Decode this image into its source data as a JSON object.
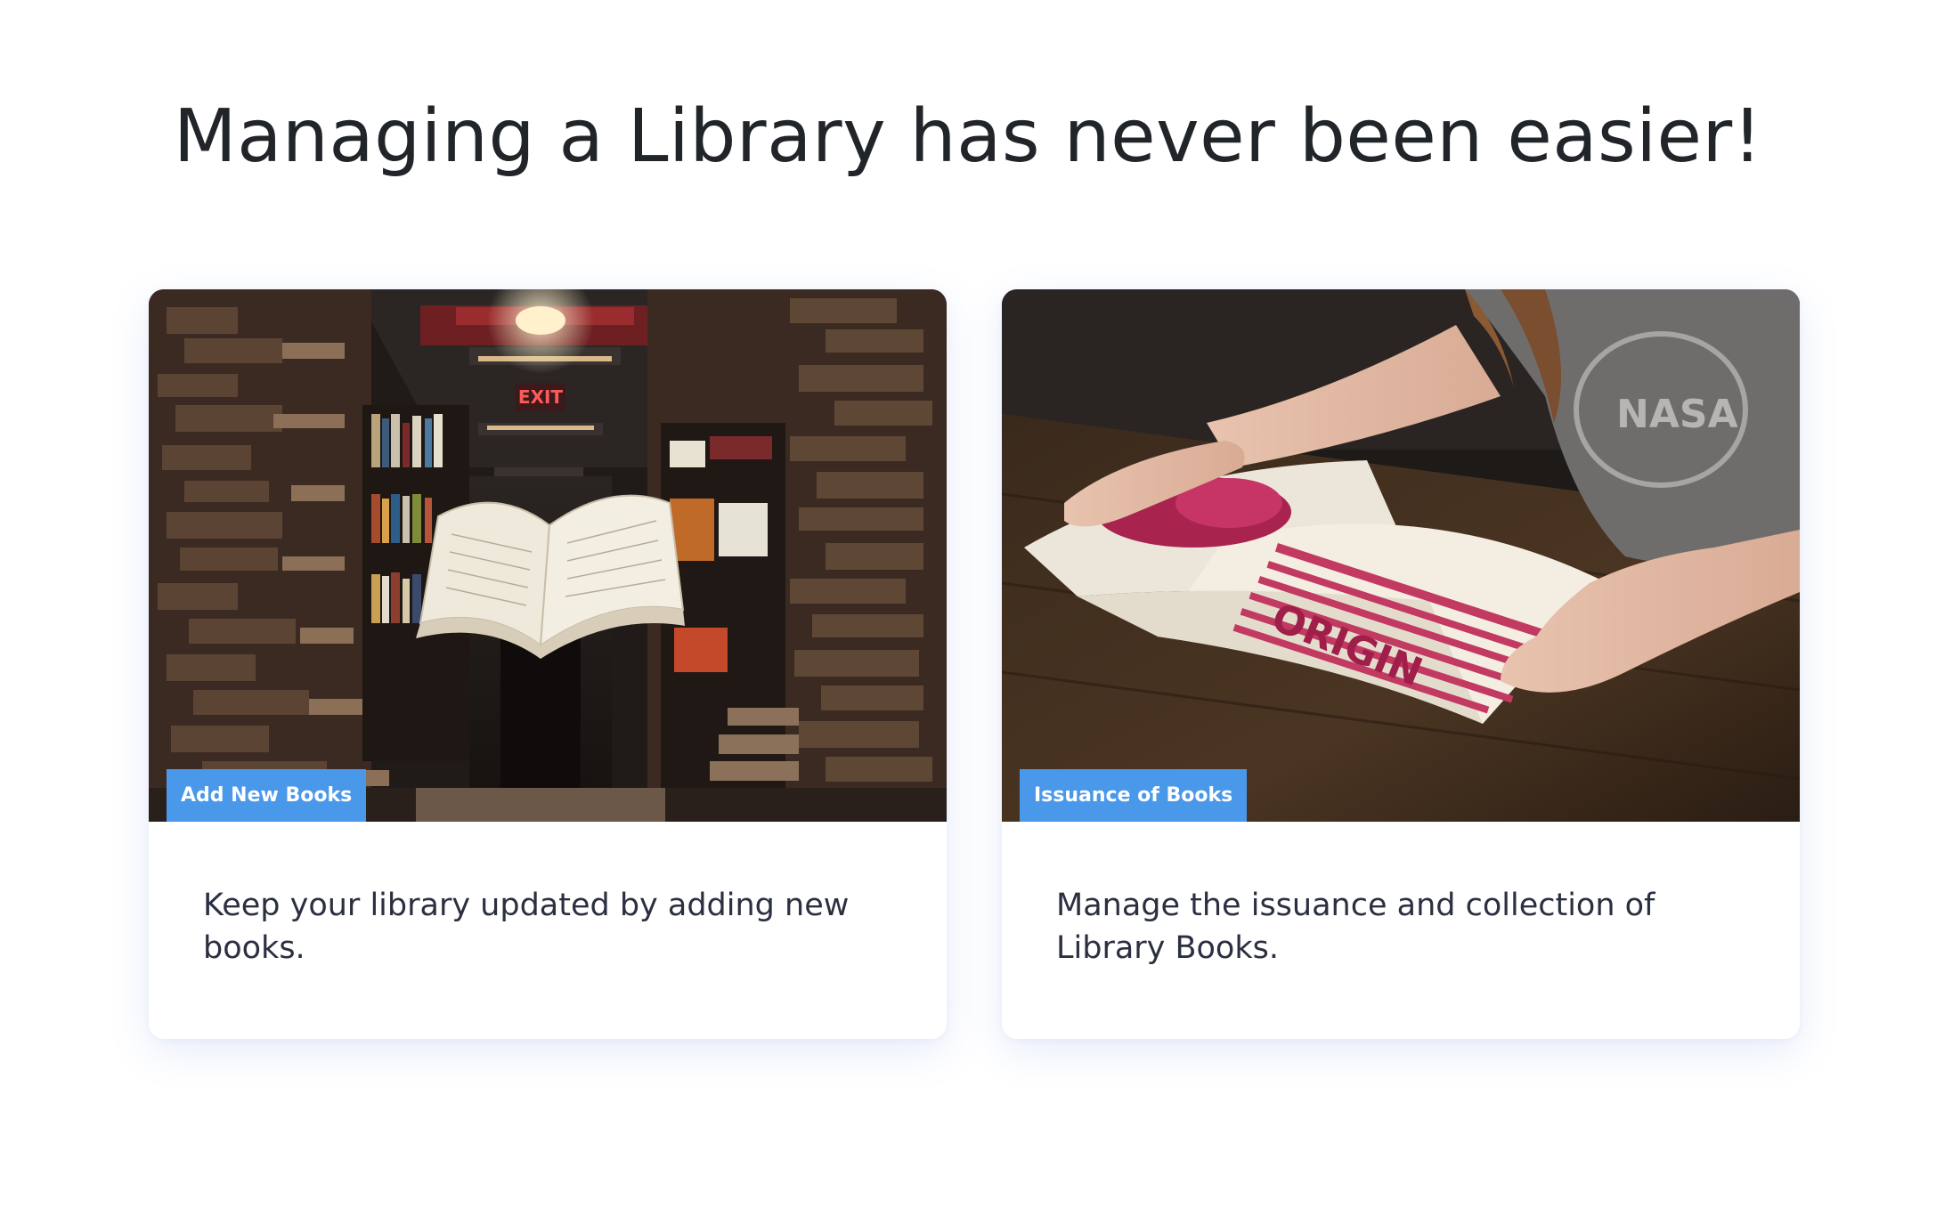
{
  "page": {
    "title": "Managing a Library has never been easier!"
  },
  "cards": [
    {
      "badge": "Add New Books",
      "description": "Keep your library updated by adding new books.",
      "image_subject": "floating open book in a dim library aisle"
    },
    {
      "badge": "Issuance of Books",
      "description": "Manage the issuance and collection of Library Books.",
      "image_subject": "person reading an open magazine on a wooden table"
    }
  ],
  "colors": {
    "badge_bg": "#4a98ea",
    "title_text": "#212529",
    "body_text": "#2b3040"
  }
}
